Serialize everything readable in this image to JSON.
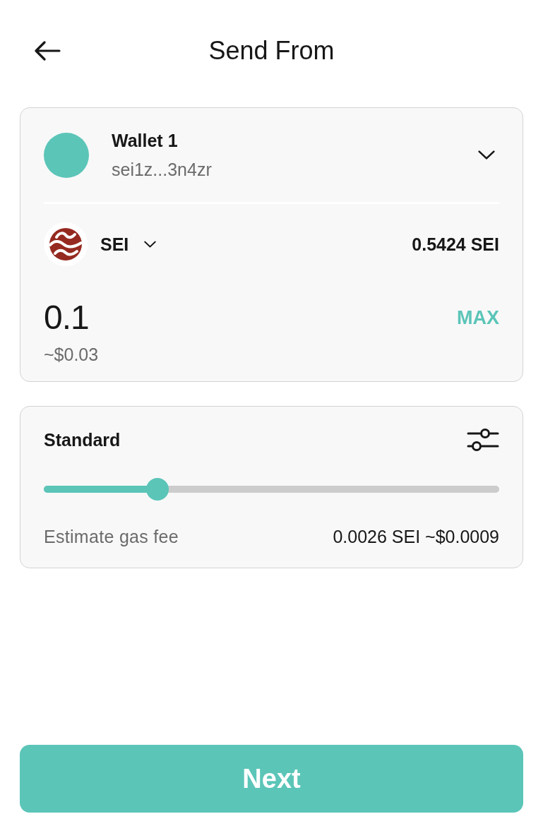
{
  "header": {
    "title": "Send From"
  },
  "account": {
    "name": "Wallet 1",
    "address": "sei1z...3n4zr"
  },
  "token": {
    "symbol": "SEI",
    "balance": "0.5424 SEI"
  },
  "amount": {
    "value": "0.1",
    "fiat": "~$0.03",
    "max_label": "MAX"
  },
  "fee": {
    "speed": "Standard",
    "level": 0.25,
    "label": "Estimate gas fee",
    "value": "0.0026 SEI ~$0.0009"
  },
  "next_button": {
    "label": "Next"
  }
}
